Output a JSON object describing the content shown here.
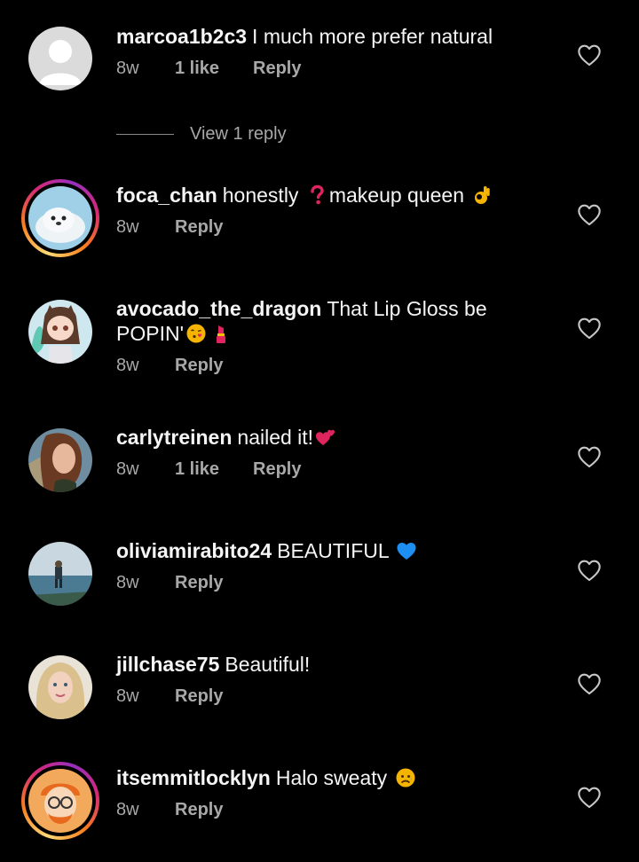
{
  "comments": [
    {
      "username": "marcoa1b2c3",
      "text": "I much more prefer natural",
      "emojis": [],
      "time": "8w",
      "likes": "1 like",
      "reply": "Reply",
      "avatar": "default-avatar-icon",
      "story_ring": false
    },
    {
      "username": "foca_chan",
      "text_parts": [
        "honestly",
        "makeup queen"
      ],
      "emojis": [
        "question-mark-emoji",
        "ok-hand-emoji"
      ],
      "time": "8w",
      "likes": "",
      "reply": "Reply",
      "avatar": "seal-photo",
      "story_ring": true
    },
    {
      "username": "avocado_the_dragon",
      "text_parts": [
        "That Lip Gloss be",
        "POPIN'"
      ],
      "emojis": [
        "kissing-face-emoji",
        "lipstick-emoji"
      ],
      "time": "8w",
      "likes": "",
      "reply": "Reply",
      "avatar": "anime-character-avatar",
      "story_ring": false
    },
    {
      "username": "carlytreinen",
      "text": "nailed it!",
      "emojis": [
        "two-hearts-emoji"
      ],
      "time": "8w",
      "likes": "1 like",
      "reply": "Reply",
      "avatar": "woman-photo",
      "story_ring": false
    },
    {
      "username": "oliviamirabito24",
      "text": "BEAUTIFUL",
      "emojis": [
        "blue-heart-emoji"
      ],
      "time": "8w",
      "likes": "",
      "reply": "Reply",
      "avatar": "beach-photo",
      "story_ring": false
    },
    {
      "username": "jillchase75",
      "text": "Beautiful!",
      "emojis": [],
      "time": "8w",
      "likes": "",
      "reply": "Reply",
      "avatar": "blonde-woman-photo",
      "story_ring": false
    },
    {
      "username": "itsemmitlocklyn",
      "text": "Halo sweaty",
      "emojis": [
        "sad-face-emoji"
      ],
      "time": "8w",
      "likes": "",
      "reply": "Reply",
      "avatar": "cartoon-avatar",
      "story_ring": true
    }
  ],
  "view_replies": "View 1 reply",
  "icons": {
    "like": "heart-outline-icon"
  },
  "colors": {
    "background": "#000000",
    "text": "#f5f5f5",
    "muted": "#a8a8a8"
  }
}
